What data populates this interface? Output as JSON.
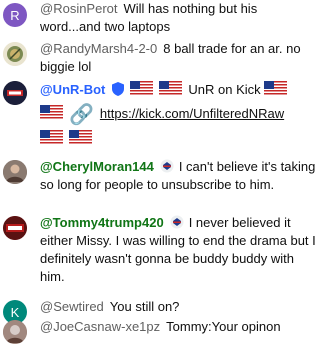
{
  "messages": [
    {
      "author": "@RosinPerot",
      "text": "Will has nothing but his word...and two laptops",
      "avatar_letter": "R",
      "avatar_color": "#7e57c2"
    },
    {
      "author": "@RandyMarsh4-2-0",
      "text": "8 ball trade for an ar. no biggie lol"
    },
    {
      "author": "@UnR-Bot",
      "text": "UnR on Kick",
      "link": "https://kick.com/UnfilteredNRaw"
    },
    {
      "author": "@CherylMoran144",
      "text": "I can't believe it's taking so long for people to unsubscribe to him."
    },
    {
      "author": "@Tommy4trump420",
      "text": "I never believed it either Missy. I was willing to end the drama but I definitely wasn't gonna be buddy buddy with him."
    },
    {
      "author": "@Sewtired",
      "text": "You still on?",
      "avatar_letter": "K",
      "avatar_color": "#00897b"
    },
    {
      "author": "@JoeCasnaw-xe1pz",
      "text": "Tommy:Your opinon"
    }
  ],
  "colors": {
    "bot_name": "#2962ff",
    "member_name": "#107516",
    "author_default": "#606060"
  }
}
